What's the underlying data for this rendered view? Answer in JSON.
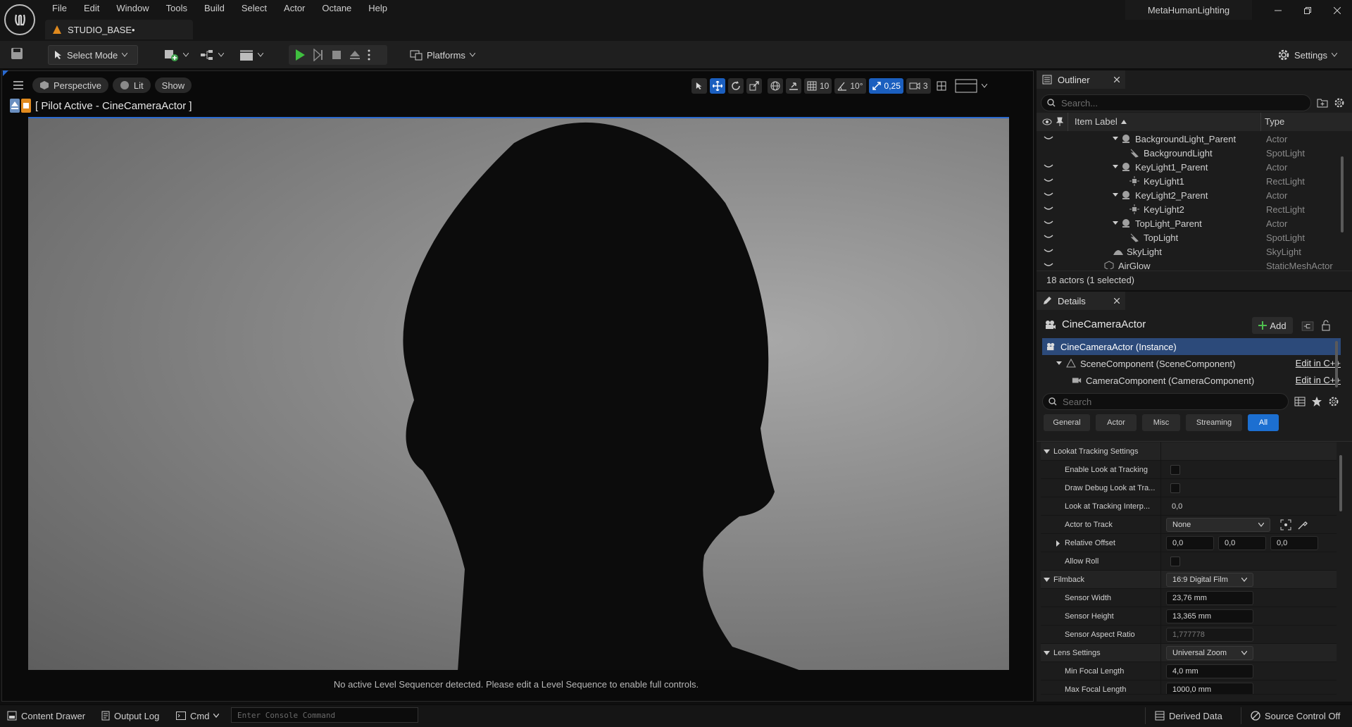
{
  "menu": [
    "File",
    "Edit",
    "Window",
    "Tools",
    "Build",
    "Select",
    "Actor",
    "Octane",
    "Help"
  ],
  "document_tab": "STUDIO_BASE•",
  "project_name": "MetaHumanLighting",
  "toolbar": {
    "select_mode": "Select Mode",
    "platforms": "Platforms",
    "settings": "Settings"
  },
  "viewport": {
    "perspective": "Perspective",
    "lit": "Lit",
    "show": "Show",
    "pilot_label": "[ Pilot Active - CineCameraActor ]",
    "grid_snap": "10",
    "rot_snap": "10°",
    "scale_snap": "0,25",
    "camera_speed": "3",
    "message": "No active Level Sequencer detected. Please edit a Level Sequence to enable full controls."
  },
  "outliner": {
    "tab": "Outliner",
    "search_placeholder": "Search...",
    "col_label": "Item Label",
    "col_type": "Type",
    "rows": [
      {
        "label": "BackgroundLight_Parent",
        "type": "Actor"
      },
      {
        "label": "BackgroundLight",
        "type": "SpotLight"
      },
      {
        "label": "KeyLight1_Parent",
        "type": "Actor"
      },
      {
        "label": "KeyLight1",
        "type": "RectLight"
      },
      {
        "label": "KeyLight2_Parent",
        "type": "Actor"
      },
      {
        "label": "KeyLight2",
        "type": "RectLight"
      },
      {
        "label": "TopLight_Parent",
        "type": "Actor"
      },
      {
        "label": "TopLight",
        "type": "SpotLight"
      },
      {
        "label": "SkyLight",
        "type": "SkyLight"
      },
      {
        "label": "AirGlow",
        "type": "StaticMeshActor"
      }
    ],
    "footer": "18 actors (1 selected)"
  },
  "details": {
    "tab": "Details",
    "actor_name": "CineCameraActor",
    "add_label": "Add",
    "components": [
      {
        "label": "CineCameraActor (Instance)"
      },
      {
        "label": "SceneComponent (SceneComponent)",
        "edit": "Edit in C++"
      },
      {
        "label": "CameraComponent (CameraComponent)",
        "edit": "Edit in C++"
      }
    ],
    "search_placeholder": "Search",
    "categories": [
      "General",
      "Actor",
      "Misc",
      "Streaming",
      "All"
    ],
    "props": {
      "lookat_header": "Lookat Tracking Settings",
      "enable_look": "Enable Look at Tracking",
      "draw_debug": "Draw Debug Look at Tra...",
      "interp": "Look at Tracking Interp...",
      "interp_val": "0,0",
      "actor_to_track": "Actor to Track",
      "actor_to_track_val": "None",
      "relative_offset": "Relative Offset",
      "offset_x": "0,0",
      "offset_y": "0,0",
      "offset_z": "0,0",
      "allow_roll": "Allow Roll",
      "filmback_header": "Filmback",
      "filmback_val": "16:9 Digital Film",
      "sensor_width": "Sensor Width",
      "sensor_width_val": "23,76 mm",
      "sensor_height": "Sensor Height",
      "sensor_height_val": "13,365 mm",
      "aspect": "Sensor Aspect Ratio",
      "aspect_val": "1,777778",
      "lens_header": "Lens Settings",
      "lens_val": "Universal Zoom",
      "min_focal": "Min Focal Length",
      "min_focal_val": "4,0 mm",
      "max_focal": "Max Focal Length",
      "max_focal_val": "1000,0 mm"
    }
  },
  "statusbar": {
    "content_drawer": "Content Drawer",
    "output_log": "Output Log",
    "cmd": "Cmd",
    "console_placeholder": "Enter Console Command",
    "derived_data": "Derived Data",
    "source_control": "Source Control Off"
  }
}
